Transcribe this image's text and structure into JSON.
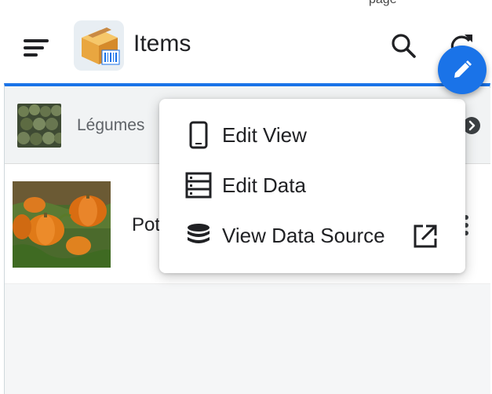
{
  "header": {
    "partial_top_text": "page",
    "title": "Items"
  },
  "group": {
    "label": "Légumes"
  },
  "list": {
    "rows": [
      {
        "title": "Pot"
      }
    ]
  },
  "context_menu": {
    "items": [
      {
        "label": "Edit View",
        "icon": "phone-outline-icon"
      },
      {
        "label": "Edit Data",
        "icon": "table-rows-icon"
      },
      {
        "label": "View Data Source",
        "icon": "database-icon",
        "trailing_icon": "open-in-new-icon"
      }
    ]
  },
  "colors": {
    "accent": "#1a73e8",
    "pumpkin": "#e8741a"
  },
  "icons": {
    "nav": "menu-icon",
    "search": "search-icon",
    "refresh": "refresh-icon",
    "fab": "pencil-icon",
    "group_toggle": "chevron-right-circle-icon",
    "row_actions": "more-vert-icon"
  }
}
